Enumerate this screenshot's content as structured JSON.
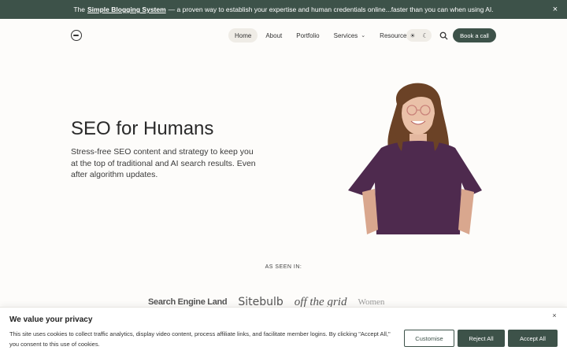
{
  "announcement": {
    "prefix": "The",
    "link_text": "Simple Blogging System",
    "suffix": "— a proven way to establish your expertise and human credentials online...faster than you can when using AI.",
    "close_label": "×"
  },
  "header": {
    "nav": [
      {
        "label": "Home",
        "active": true
      },
      {
        "label": "About"
      },
      {
        "label": "Portfolio"
      },
      {
        "label": "Services",
        "has_dropdown": true
      },
      {
        "label": "Resources",
        "has_dropdown": true
      }
    ],
    "theme_toggle": {
      "light_icon": "sun-icon",
      "dark_icon": "moon-icon"
    },
    "search_icon": "search-icon",
    "cta_label": "Book a call"
  },
  "hero": {
    "title": "SEO for Humans",
    "subtitle": "Stress-free SEO content and strategy to keep you at the top of traditional and AI search results. Even after algorithm updates."
  },
  "seen_in": {
    "heading": "AS SEEN IN:",
    "logos": [
      "Search Engine Land",
      "Sitebulb",
      "off the grid",
      "Women"
    ]
  },
  "cookie_banner": {
    "title": "We value your privacy",
    "text": "This site uses cookies to collect traffic analytics, display video content, process affiliate links, and facilitate member logins. By clicking \"Accept All,\" you consent to this use of cookies.",
    "buttons": {
      "customise": "Customise",
      "reject": "Reject All",
      "accept": "Accept All"
    },
    "close_label": "×"
  },
  "colors": {
    "brand": "#3d5249",
    "background": "#fdfcfa",
    "shirt": "#4e2a4e"
  }
}
